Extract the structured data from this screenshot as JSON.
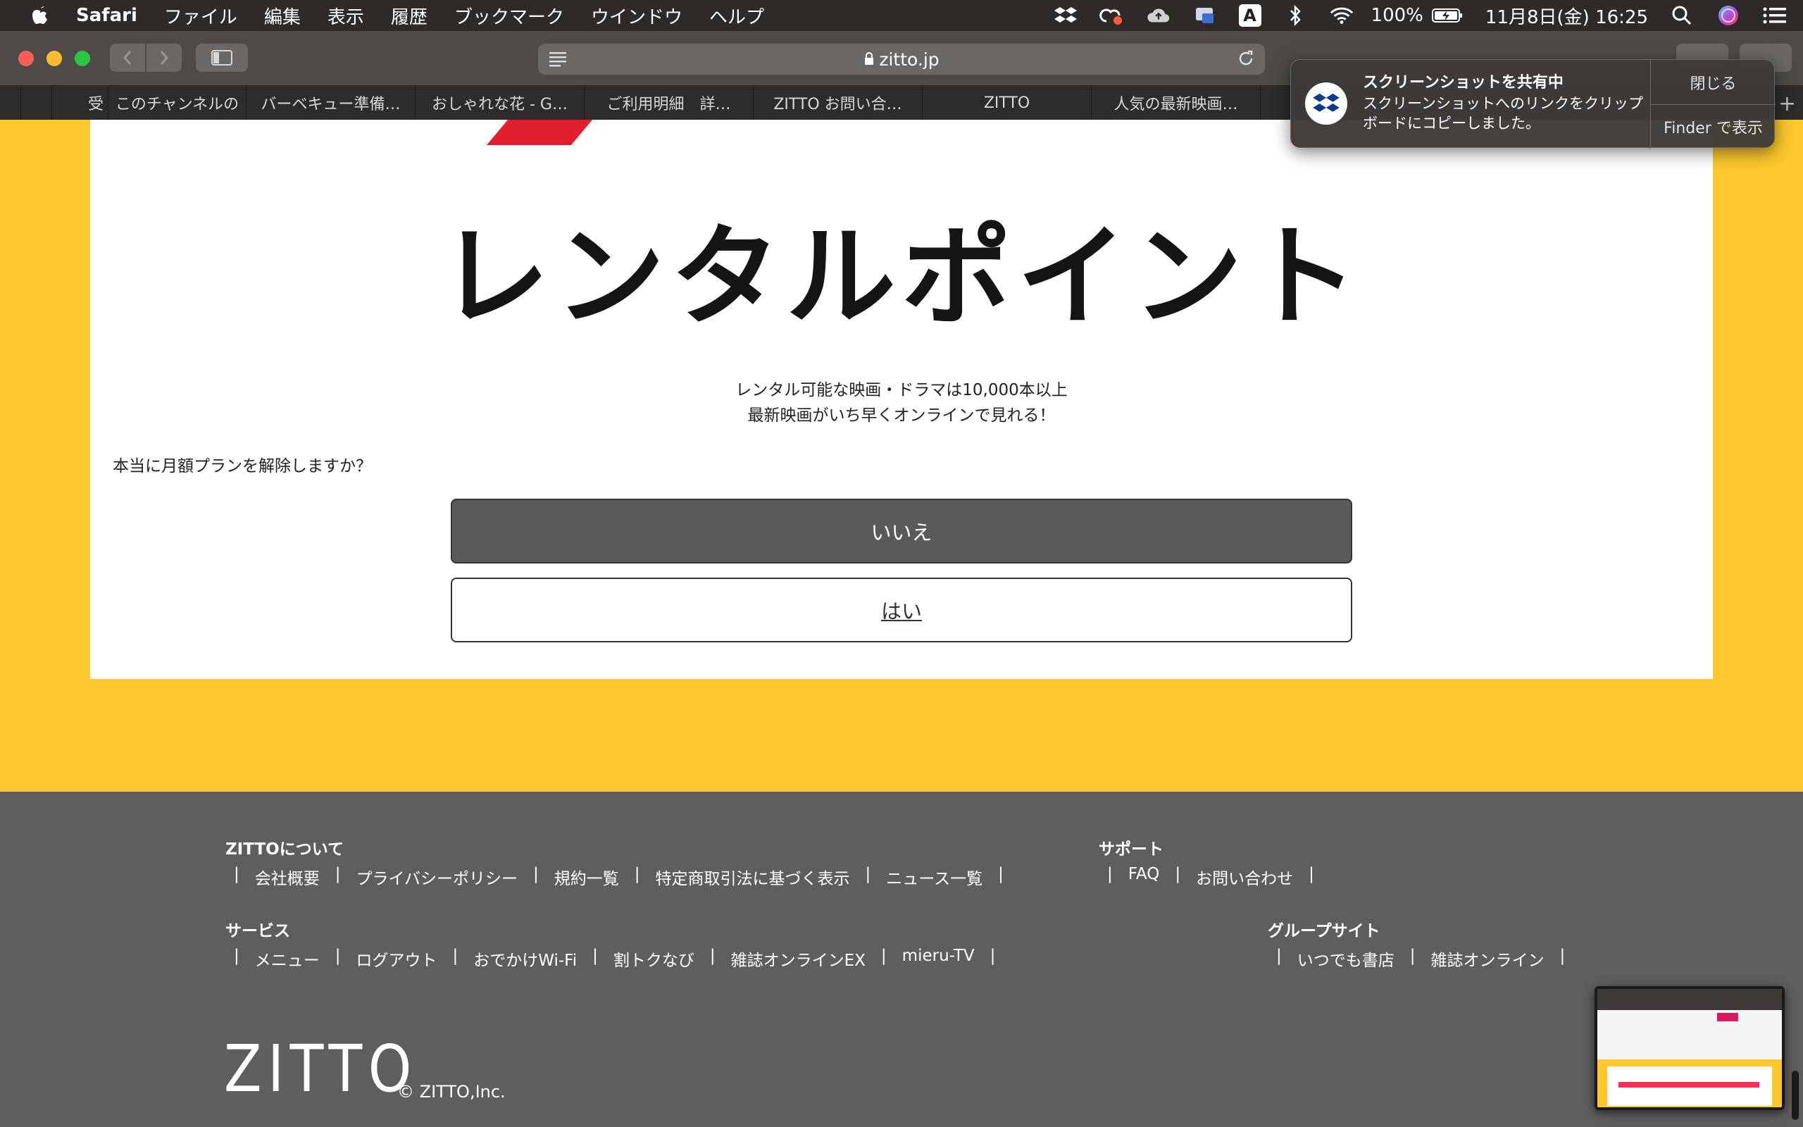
{
  "menubar": {
    "app_name": "Safari",
    "items": [
      "ファイル",
      "編集",
      "表示",
      "履歴",
      "ブックマーク",
      "ウインドウ",
      "ヘルプ"
    ],
    "battery": "100%",
    "input_mode": "A",
    "datetime": "11月8日(金) 16:25"
  },
  "browser": {
    "url": "zitto.jp",
    "tabs": [
      "受",
      "このチャンネルの",
      "バーベキュー準備…",
      "おしゃれな花 - G…",
      "ご利用明細　詳…",
      "ZITTO お問い合…",
      "ZITTO",
      "人気の最新映画…"
    ]
  },
  "page": {
    "hero_title": "レンタルポイント",
    "desc_line1": "レンタル可能な映画・ドラマは10,000本以上",
    "desc_line2": "最新映画がいち早くオンラインで見れる！",
    "question": "本当に月額プランを解除しますか？",
    "no_label": "いいえ",
    "yes_label": "はい"
  },
  "footer": {
    "about": {
      "title": "ZITTOについて",
      "links": [
        "会社概要",
        "プライバシーポリシー",
        "規約一覧",
        "特定商取引法に基づく表示",
        "ニュース一覧"
      ]
    },
    "support": {
      "title": "サポート",
      "links": [
        "FAQ",
        "お問い合わせ"
      ]
    },
    "services": {
      "title": "サービス",
      "links": [
        "メニュー",
        "ログアウト",
        "おでかけWi-Fi",
        "割トクなび",
        "雑誌オンラインEX",
        "mieru-TV"
      ]
    },
    "group": {
      "title": "グループサイト",
      "links": [
        "いつでも書店",
        "雑誌オンライン"
      ]
    },
    "logo_text": "ZITTO",
    "copyright": "© ZITTO,Inc."
  },
  "notification": {
    "title": "スクリーンショットを共有中",
    "body": "スクリーンショットへのリンクをクリップボードにコピーしました。",
    "close_label": "閉じる",
    "finder_label": "Finder で表示"
  },
  "colors": {
    "page_bg": "#fcc82e",
    "footer_bg": "#5e5e5e",
    "accent_red": "#e21f2c",
    "no_button_bg": "#5a5a5a"
  },
  "icons": [
    "apple-icon",
    "dropbox-icon",
    "creative-cloud-icon",
    "cloud-upload-icon",
    "bluetooth-icon",
    "wifi-icon",
    "battery-icon",
    "search-icon",
    "siri-icon",
    "notification-center-icon",
    "reader-icon",
    "reload-icon",
    "lock-icon",
    "share-icon",
    "tabs-icon"
  ]
}
